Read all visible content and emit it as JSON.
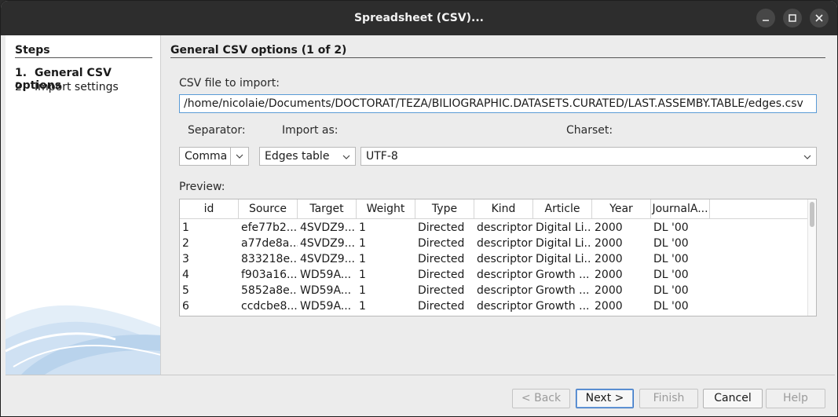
{
  "window": {
    "title": "Spreadsheet (CSV)..."
  },
  "sidebar": {
    "title": "Steps",
    "steps": [
      {
        "num": "1.",
        "label": "General CSV options",
        "active": true
      },
      {
        "num": "2.",
        "label": "Import settings",
        "active": false
      }
    ]
  },
  "main": {
    "title": "General CSV options (1 of 2)",
    "csv_file_label": "CSV file to import:",
    "csv_file_value": "/home/nicolaie/Documents/DOCTORAT/TEZA/BILIOGRAPHIC.DATASETS.CURATED/LAST.ASSEMBY.TABLE/edges.csv",
    "separator_label": "Separator:",
    "separator_value": "Comma",
    "import_as_label": "Import as:",
    "import_as_value": "Edges table",
    "charset_label": "Charset:",
    "charset_value": "UTF-8",
    "preview_label": "Preview:"
  },
  "preview": {
    "columns": [
      "id",
      "Source",
      "Target",
      "Weight",
      "Type",
      "Kind",
      "Article",
      "Year",
      "JournalA..."
    ],
    "rows": [
      [
        "1",
        "efe77b2...",
        "4SVDZ9...",
        "1",
        "Directed",
        "descriptor",
        "Digital Li...",
        "2000",
        "DL '00"
      ],
      [
        "2",
        "a77de8a...",
        "4SVDZ9...",
        "1",
        "Directed",
        "descriptor",
        "Digital Li...",
        "2000",
        "DL '00"
      ],
      [
        "3",
        "833218e...",
        "4SVDZ9...",
        "1",
        "Directed",
        "descriptor",
        "Digital Li...",
        "2000",
        "DL '00"
      ],
      [
        "4",
        "f903a16...",
        "WD59A...",
        "1",
        "Directed",
        "descriptor",
        "Growth ...",
        "2000",
        "DL '00"
      ],
      [
        "5",
        "5852a8e...",
        "WD59A...",
        "1",
        "Directed",
        "descriptor",
        "Growth ...",
        "2000",
        "DL '00"
      ],
      [
        "6",
        "ccdcbe8...",
        "WD59A...",
        "1",
        "Directed",
        "descriptor",
        "Growth ...",
        "2000",
        "DL '00"
      ]
    ]
  },
  "footer": {
    "back_label": "< Back",
    "next_label": "Next >",
    "finish_label": "Finish",
    "cancel_label": "Cancel",
    "help_label": "Help"
  },
  "colors": {
    "titlebar": "#2d2d2d",
    "accent": "#3b76c4",
    "window_bg": "#ececec"
  }
}
